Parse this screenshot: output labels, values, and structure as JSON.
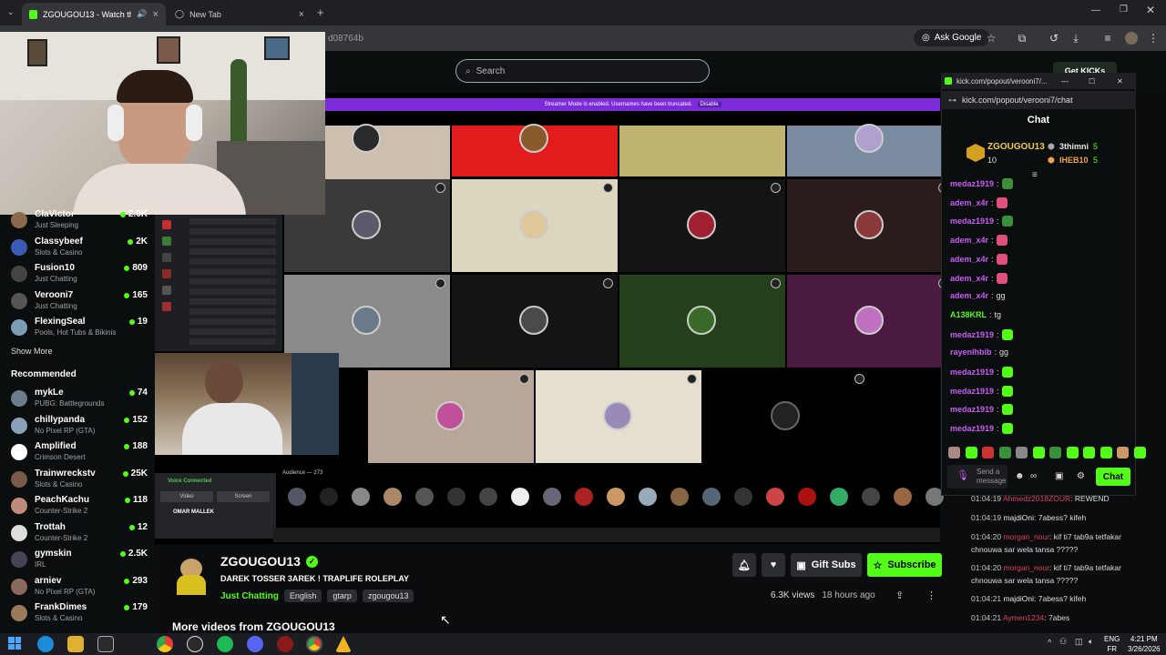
{
  "browser": {
    "tabs": [
      {
        "label": "ZGOUGOU13 - Watch the",
        "active": true
      },
      {
        "label": "New Tab",
        "active": false
      }
    ],
    "url": "d08764b",
    "ask_google": "Ask Google"
  },
  "kick": {
    "search_placeholder": "Search",
    "get_kicks": "Get KICKs"
  },
  "stream_overlay": {
    "streamer_mode": "Streamer Mode is enabled. Usernames have been truncated.",
    "disable": "Disable",
    "audience": "Audience — 273",
    "voice_connected": "Voice Connected",
    "video": "Video",
    "screen": "Screen",
    "voice_user": "OMAR MALLEK"
  },
  "sidebar": {
    "following": [
      {
        "name": "ClaVictor",
        "category": "Just Sleeping",
        "viewers": "2.0K",
        "color": "#8a6a4a"
      },
      {
        "name": "Classybeef",
        "category": "Slots & Casino",
        "viewers": "2K",
        "color": "#3b5bb5"
      },
      {
        "name": "Fusion10",
        "category": "Just Chatting",
        "viewers": "809",
        "color": "#444"
      },
      {
        "name": "Verooni7",
        "category": "Just Chatting",
        "viewers": "165",
        "color": "#555"
      },
      {
        "name": "FlexingSeal",
        "category": "Pools, Hot Tubs & Bikinis",
        "viewers": "19",
        "color": "#7c9bb7"
      }
    ],
    "show_more": "Show More",
    "recommended_label": "Recommended",
    "recommended": [
      {
        "name": "mykLe",
        "category": "PUBG: Battlegrounds",
        "viewers": "74",
        "color": "#6a7d8c"
      },
      {
        "name": "chillypanda",
        "category": "No Pixel RP (GTA)",
        "viewers": "152",
        "color": "#8aa0b8"
      },
      {
        "name": "Amplified",
        "category": "Crimson Desert",
        "viewers": "188",
        "color": "#ffffff"
      },
      {
        "name": "Trainwreckstv",
        "category": "Slots & Casino",
        "viewers": "25K",
        "color": "#7a5a48"
      },
      {
        "name": "PeachKachu",
        "category": "Counter-Strike 2",
        "viewers": "118",
        "color": "#c08a7a"
      },
      {
        "name": "Trottah",
        "category": "Counter-Strike 2",
        "viewers": "12",
        "color": "#ddd"
      },
      {
        "name": "gymskin",
        "category": "IRL",
        "viewers": "2.5K",
        "color": "#445"
      },
      {
        "name": "arniev",
        "category": "No Pixel RP (GTA)",
        "viewers": "293",
        "color": "#8a6a5a"
      },
      {
        "name": "FrankDimes",
        "category": "Slots & Casino",
        "viewers": "179",
        "color": "#9a7a5a"
      }
    ]
  },
  "channel": {
    "name": "ZGOUGOU13",
    "title": "DAREK TOSSER 3AREK ! TRAPLIFE ROLEPLAY",
    "category": "Just Chatting",
    "tags": [
      "English",
      "gtarp",
      "zgougou13"
    ],
    "gift_subs": "Gift Subs",
    "subscribe": "Subscribe",
    "views": "6.3K views",
    "time_ago": "18 hours ago",
    "more_videos": "More videos from ZGOUGOU13"
  },
  "chat_popup": {
    "window_url": "kick.com/popout/verooni7/...",
    "address": "kick.com/popout/verooni7/chat",
    "heading": "Chat",
    "top_gifters": [
      {
        "name": "ZGOUGOU13",
        "count": "10",
        "color": "#f2c94c"
      },
      {
        "name": "3thimni",
        "count": "5",
        "color": "#e8e8e8"
      },
      {
        "name": "IHEB10",
        "count": "5",
        "color": "#f2a24c"
      }
    ],
    "messages": [
      {
        "user": "medaz1919",
        "text": "",
        "color": "#c85cf2",
        "emote": "#3a8f3a"
      },
      {
        "user": "adem_x4r",
        "text": "",
        "color": "#c85cf2",
        "emote": "#e0507a"
      },
      {
        "user": "medaz1919",
        "text": "",
        "color": "#c85cf2",
        "emote": "#3a8f3a"
      },
      {
        "user": "adem_x4r",
        "text": "",
        "color": "#c85cf2",
        "emote": "#e0507a"
      },
      {
        "user": "adem_x4r",
        "text": "",
        "color": "#c85cf2",
        "emote": "#e0507a"
      },
      {
        "user": "adem_x4r",
        "text": "",
        "color": "#c85cf2",
        "emote": "#e0507a"
      },
      {
        "user": "adem_x4r",
        "text": "gg",
        "color": "#c85cf2",
        "emote": ""
      },
      {
        "user": "A138KRL",
        "text": "tg",
        "color": "#53fc18",
        "emote": ""
      },
      {
        "user": "medaz1919",
        "text": "",
        "color": "#c85cf2",
        "emote": "#53fc18"
      },
      {
        "user": "rayenlhbib",
        "text": "gg",
        "color": "#c85cf2",
        "emote": ""
      },
      {
        "user": "medaz1919",
        "text": "",
        "color": "#c85cf2",
        "emote": "#53fc18"
      },
      {
        "user": "medaz1919",
        "text": "",
        "color": "#c85cf2",
        "emote": "#53fc18"
      },
      {
        "user": "medaz1919",
        "text": "",
        "color": "#c85cf2",
        "emote": "#53fc18"
      },
      {
        "user": "medaz1919",
        "text": "",
        "color": "#c85cf2",
        "emote": "#53fc18"
      }
    ],
    "send_placeholder": "Send a message",
    "chat_button": "Chat"
  },
  "replay_chat": [
    {
      "time": "01:04:19",
      "user": "Ahmedz2018ZOUR",
      "text": "REWEND",
      "color": "#e0415a"
    },
    {
      "time": "01:04:19",
      "user": "majdiOni",
      "text": "7abess? kifeh",
      "color": "#e8e8e8"
    },
    {
      "time": "01:04:20",
      "user": "morgan_nour",
      "text": "kif ti7 tab9a tetfakar chnouwa sar wela tansa ?????",
      "color": "#e0415a"
    },
    {
      "time": "01:04:20",
      "user": "morgan_nour",
      "text": "kif ti7 tab9a tetfakar chnouwa sar wela tansa ?????",
      "color": "#e0415a"
    },
    {
      "time": "01:04:21",
      "user": "majdiOni",
      "text": "7abess? kifeh",
      "color": "#e8e8e8"
    },
    {
      "time": "01:04:21",
      "user": "Aymen1234",
      "text": "7abes",
      "color": "#e0415a"
    }
  ],
  "taskbar": {
    "lang_top": "ENG",
    "lang_bottom": "FR",
    "time": "4:21 PM",
    "date": "3/26/2026"
  }
}
